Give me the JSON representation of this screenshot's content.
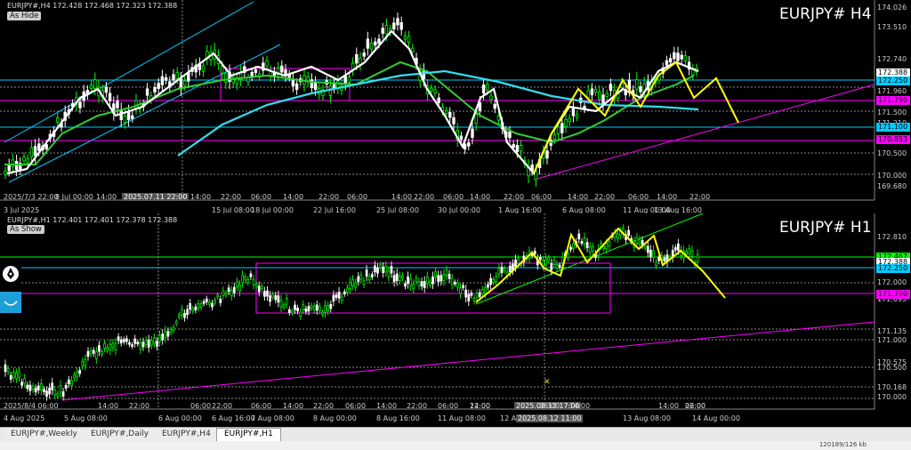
{
  "panel_h4": {
    "ohlc": "EURJPY#,H4  172.428 172.468 172.323 172.388",
    "label": "EURJPY# H4",
    "as_hide": "As Hide",
    "y_ticks": [
      "174.026",
      "173.510",
      "172.740",
      "171.960",
      "171.500",
      "171.210",
      "170.500",
      "170.000",
      "169.680"
    ],
    "price_boxes": [
      {
        "text": "172.388",
        "bg": "#ffffff",
        "fg": "#000000"
      },
      {
        "text": "172.250",
        "bg": "#00ccff",
        "fg": "#000000"
      },
      {
        "text": "171.790",
        "bg": "#ff00ff",
        "fg": "#000000"
      },
      {
        "text": "171.100",
        "bg": "#00ccff",
        "fg": "#000000"
      },
      {
        "text": "170.853",
        "bg": "#ff00ff",
        "fg": "#000000"
      }
    ],
    "x_ticks": [
      "3 Jul 2025",
      "2025/7/3 22:00",
      "8 Jul 00:00",
      "14:00",
      "2025.07.11 22:00",
      "14:00",
      "15 Jul 08:00",
      "22:00",
      "06:00",
      "18 Jul 00:00",
      "14:00",
      "22 Jul 16:00",
      "22:00",
      "06:00",
      "25 Jul 08:00",
      "14:00",
      "22:00",
      "30 Jul 00:00",
      "06:00",
      "14:00",
      "1 Aug 16:00",
      "22:00",
      "06:00",
      "6 Aug 08:00",
      "14:00",
      "22:00",
      "11 Aug 00:00",
      "06:00",
      "13 Aug 16:00",
      "14:00",
      "22:00"
    ]
  },
  "panel_h1": {
    "ohlc": "EURJPY#,H1  172.401 172.401 172.378 172.388",
    "label": "EURJPY# H1",
    "as_show": "As Show",
    "y_ticks": [
      "172.810",
      "172.000",
      "171.695",
      "171.135",
      "171.000",
      "170.575",
      "170.500",
      "170.168",
      "170.000"
    ],
    "price_boxes": [
      {
        "text": "172.467",
        "bg": "#00ff00",
        "fg": "#000000"
      },
      {
        "text": "172.388",
        "bg": "#ffffff",
        "fg": "#000000"
      },
      {
        "text": "172.250",
        "bg": "#00ccff",
        "fg": "#000000"
      },
      {
        "text": "171.790",
        "bg": "#ff00ff",
        "fg": "#000000"
      }
    ],
    "x_ticks": [
      "4 Aug 2025",
      "2025/8/4 06:00",
      "5 Aug 08:00",
      "14:00",
      "22:00",
      "6 Aug 00:00",
      "06:00",
      "6 Aug 16:00",
      "22:00",
      "06:00",
      "7 Aug 08:00",
      "14:00",
      "22:00",
      "8 Aug 00:00",
      "06:00",
      "14:00",
      "8 Aug 16:00",
      "22:00",
      "06:00",
      "11 Aug 08:00",
      "14:00",
      "22:00",
      "12 Aug 00:00",
      "2025.08.12 17:00",
      "2025.08.12 11:00",
      "06:00",
      "14:00",
      "13 Aug 08:00",
      "14:00",
      "22:00",
      "06:00",
      "14 Aug 00:00"
    ]
  },
  "tabs": [
    "EURJPY#,Weekly",
    "EURJPY#,Daily",
    "EURJPY#,H4",
    "EURJPY#,H1"
  ],
  "active_tab": "EURJPY#,H1",
  "status_right": "120189/126 kb",
  "colors": {
    "up": "#00ff00",
    "down": "#ffffff",
    "ma_white": "#ffffff",
    "ma_green": "#33cc33",
    "ma_cyan": "#33ddee",
    "forecast": "#ffff00",
    "trend": "#ff00ff",
    "channel": "#00ccff"
  }
}
